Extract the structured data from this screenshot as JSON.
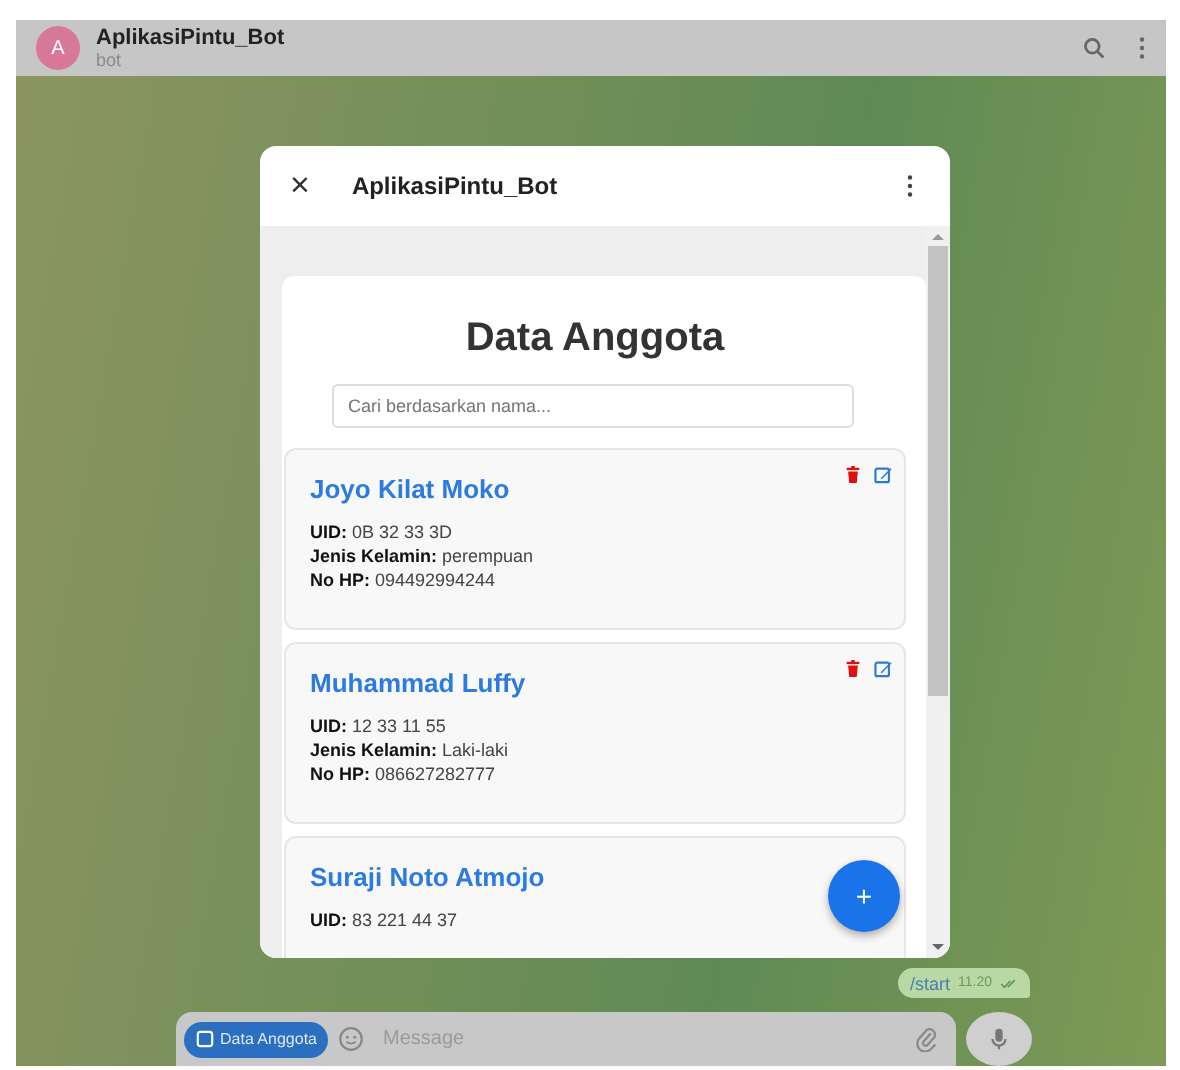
{
  "chat_header": {
    "avatar_letter": "A",
    "title": "AplikasiPintu_Bot",
    "subtitle": "bot"
  },
  "web_app": {
    "title": "AplikasiPintu_Bot",
    "close": "×",
    "heading": "Data Anggota",
    "search": {
      "placeholder": "Cari berdasarkan nama..."
    },
    "members": [
      {
        "name": "Joyo Kilat Moko",
        "lines": [
          "**UID:** 0B 32 33 3D",
          "**Jenis Kelamin:** perempuan",
          "**No HP:** 094492994244"
        ],
        "actions": true
      },
      {
        "name": "Muhammad Luffy",
        "lines": [
          "**UID:** 12 33 11 55",
          "**Jenis Kelamin:** Laki-laki",
          "**No HP:** 086627282777"
        ],
        "actions": true
      },
      {
        "name": "Suraji Noto Atmojo",
        "lines": [
          "**UID:** 83 221 44 37"
        ],
        "actions": false
      }
    ],
    "fab": "+"
  },
  "message": {
    "text": "/start",
    "time": "11.20"
  },
  "composer": {
    "menu_button": "Data Anggota",
    "placeholder": "Message"
  }
}
